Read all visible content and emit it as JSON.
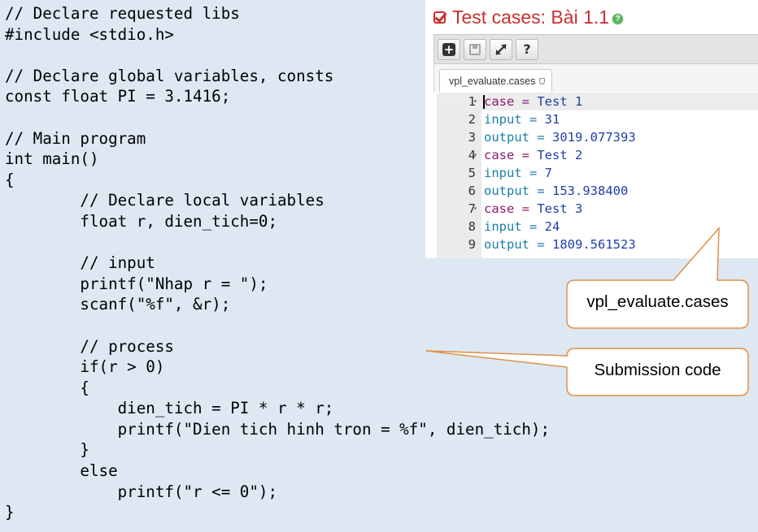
{
  "source_code": [
    "// Declare requested libs",
    "#include <stdio.h>",
    "",
    "// Declare global variables, consts",
    "const float PI = 3.1416;",
    "",
    "// Main program",
    "int main()",
    "{",
    "        // Declare local variables",
    "        float r, dien_tich=0;",
    "",
    "        // input",
    "        printf(\"Nhap r = \");",
    "        scanf(\"%f\", &r);",
    "",
    "        // process",
    "        if(r > 0)",
    "        {",
    "            dien_tich = PI * r * r;",
    "            printf(\"Dien tich hinh tron = %f\", dien_tich);",
    "        }",
    "        else",
    "            printf(\"r <= 0\");",
    "}"
  ],
  "panel": {
    "title": "Test cases: Bài 1.1",
    "help_icon": "?",
    "toolbar_icons": [
      "add-icon",
      "save-icon",
      "fullscreen-icon",
      "help-icon"
    ],
    "help_button_label": "?",
    "tab_label": "vpl_evaluate.cases",
    "editor_lines": [
      {
        "num": "1",
        "fold": true,
        "key": "case",
        "value": "Test 1"
      },
      {
        "num": "2",
        "fold": false,
        "key": "input",
        "value": "31"
      },
      {
        "num": "3",
        "fold": false,
        "key": "output",
        "value": "3019.077393"
      },
      {
        "num": "4",
        "fold": true,
        "key": "case",
        "value": "Test 2"
      },
      {
        "num": "5",
        "fold": false,
        "key": "input",
        "value": "7"
      },
      {
        "num": "6",
        "fold": false,
        "key": "output",
        "value": "153.938400"
      },
      {
        "num": "7",
        "fold": true,
        "key": "case",
        "value": "Test 3"
      },
      {
        "num": "8",
        "fold": false,
        "key": "input",
        "value": "24"
      },
      {
        "num": "9",
        "fold": false,
        "key": "output",
        "value": "1809.561523"
      }
    ]
  },
  "callouts": {
    "evaluate_cases": "vpl_evaluate.cases",
    "submission_code": "Submission code"
  },
  "colors": {
    "background": "#dde8f2",
    "title_red": "#c9302c",
    "callout_border": "#e0904a",
    "callout_fill": "#ffffff"
  }
}
